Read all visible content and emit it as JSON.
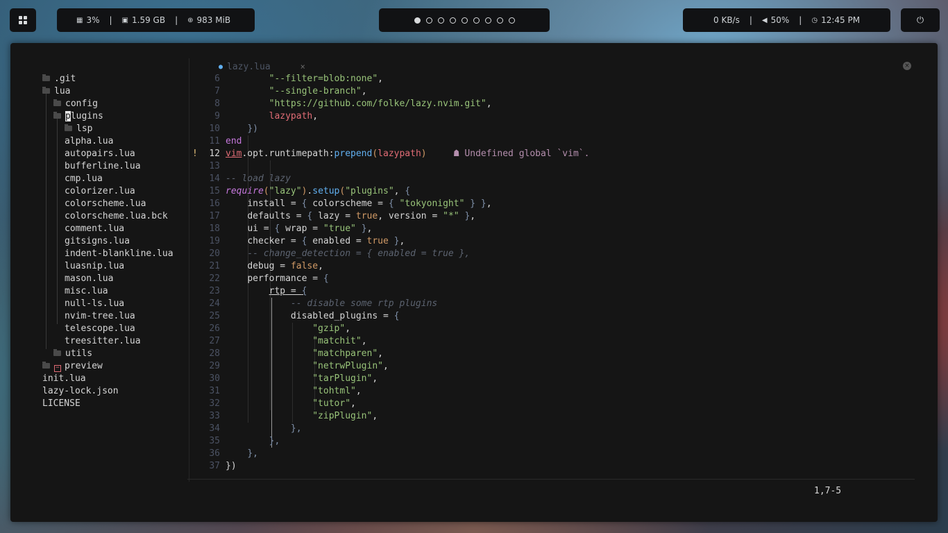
{
  "topbar": {
    "cpu": "3%",
    "ram": "1.59 GB",
    "net_mem": "983 MiB",
    "separator": "|",
    "workspaces": [
      true,
      false,
      false,
      false,
      false,
      false,
      false,
      false,
      false
    ],
    "net_speed": "0 KB/s",
    "volume": "50%",
    "clock": "12:45 PM"
  },
  "icons": {
    "launcher": "grid-icon",
    "cpu": "cpu-icon",
    "ram": "memory-icon",
    "net_mem": "globe-icon",
    "volume": "speaker-icon",
    "clock": "clock-icon",
    "power": "power-icon",
    "folder": "folder-icon",
    "tab": "file-icon",
    "diagnostic": "ghost-icon"
  },
  "colors": {
    "string": "#98c379",
    "keyword": "#c678dd",
    "boolean": "#d19a66",
    "function": "#61afef",
    "comment": "#5c6370",
    "error": "#e06c75",
    "warning_sign": "#e5c07b"
  },
  "tree": {
    "items": [
      ".git",
      "lua",
      "config",
      "plugins",
      "lsp",
      "alpha.lua",
      "autopairs.lua",
      "bufferline.lua",
      "cmp.lua",
      "colorizer.lua",
      "colorscheme.lua",
      "colorscheme.lua.bck",
      "comment.lua",
      "gitsigns.lua",
      "indent-blankline.lua",
      "luasnip.lua",
      "mason.lua",
      "misc.lua",
      "null-ls.lua",
      "nvim-tree.lua",
      "telescope.lua",
      "treesitter.lua",
      "utils",
      "preview",
      "init.lua",
      "lazy-lock.json",
      "LICENSE"
    ],
    "plugins_first_char": "p",
    "plugins_rest": "lugins",
    "git_marker": "−"
  },
  "editor": {
    "tab_name": "lazy.lua",
    "tab_close": "×",
    "window_close": "×",
    "line_numbers": [
      "6",
      "7",
      "8",
      "9",
      "10",
      "11",
      "12",
      "13",
      "14",
      "15",
      "16",
      "17",
      "18",
      "19",
      "20",
      "21",
      "22",
      "23",
      "24",
      "25",
      "26",
      "27",
      "28",
      "29",
      "30",
      "31",
      "32",
      "33",
      "34",
      "35",
      "36",
      "37"
    ],
    "warning_sign": "!",
    "diagnostic": "Undefined global `vim`.",
    "cursor_pos": "1,7-5"
  },
  "code": {
    "l6": "\"--filter=blob:none\"",
    "l7": "\"--single-branch\"",
    "l8": "\"https://github.com/folke/lazy.nvim.git\"",
    "l9": "lazypath",
    "l10": "})",
    "l11": "end",
    "l12_vim": "vim",
    "l12_opt": ".opt.runtimepath:",
    "l12_fn": "prepend",
    "l12_arg": "lazypath",
    "l14": "-- load lazy",
    "l15_req": "require",
    "l15_arg": "\"lazy\"",
    "l15_setup": "setup",
    "l15_str": "\"plugins\"",
    "l16_key": "install",
    "l16_key2": "colorscheme",
    "l16_str": "\"tokyonight\"",
    "l17_key": "defaults",
    "l17_key2": "lazy",
    "l17_bool": "true",
    "l17_key3": "version",
    "l17_str": "\"*\"",
    "l18_key": "ui",
    "l18_key2": "wrap",
    "l18_str": "\"true\"",
    "l19_key": "checker",
    "l19_key2": "enabled",
    "l19_bool": "true",
    "l20": "-- change_detection = { enabled = true },",
    "l21_key": "debug",
    "l21_bool": "false",
    "l22_key": "performance",
    "l23_key": "rtp",
    "l24": "-- disable some rtp plugins",
    "l25_key": "disabled_plugins",
    "plugins_list": [
      "\"gzip\"",
      "\"matchit\"",
      "\"matchparen\"",
      "\"netrwPlugin\"",
      "\"tarPlugin\"",
      "\"tohtml\"",
      "\"tutor\"",
      "\"zipPlugin\""
    ],
    "l34": "},",
    "l35": "},",
    "l36": "},",
    "l37": "})"
  }
}
